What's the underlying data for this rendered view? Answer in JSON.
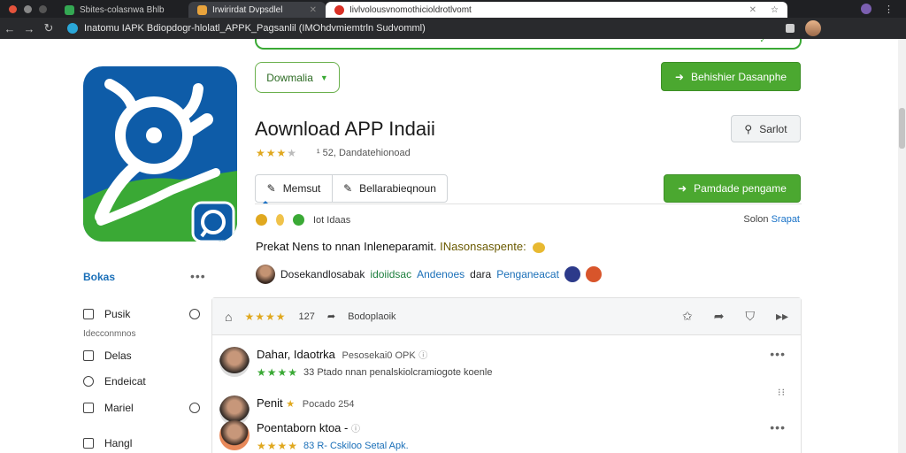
{
  "browser": {
    "tabs": [
      {
        "title": "Sbites-colasnwa Bhlb",
        "favicon_color": "#34a853"
      },
      {
        "title": "Irwirirdat Dvpsdlel",
        "favicon_color": "#e8a33c"
      },
      {
        "title": "Iivlvolousvnomothicioldrotlvomt",
        "favicon_color": "#d93025"
      }
    ],
    "address": "Inatomu IAPK Bdiopdogr-hlolatl_APPK_Pagsanlil (IMOhdvmiemtrln Sudvomml)"
  },
  "app": {
    "title": "Aownload APP Indaii",
    "rating_count": "     ¹ 52, Dandatehionoad",
    "dropdown_label": "Dowmalia",
    "primary_button": "Behishier Dasanphe",
    "share_button": "Sarlot",
    "tab_left": "Memsut",
    "tab_right": "Bellarabieqnoun",
    "install_button": "Pamdade pengame",
    "meta_text": "Iot Idaas",
    "solon_text": "Solon",
    "solon_link": "Srapat",
    "description": "Prekat Nens to nnan Inleneparamit.",
    "description_highlight": "INasonsaspente:",
    "developer_text": "Dosekandlosabak",
    "developer_green": "idoiidsac",
    "developer_blue": "Andenoes",
    "developer_mid": "dara",
    "developer_link": "Penganeacat"
  },
  "sidebar": {
    "heading": "Bokas",
    "items": [
      {
        "label": "Pusik"
      },
      {
        "label": "Delas"
      },
      {
        "label": "Endeicat"
      },
      {
        "label": "Mariel"
      },
      {
        "label": "Hangl"
      }
    ],
    "subtitle": "Idecconmnos"
  },
  "reviews": {
    "toolbar_count": "127",
    "toolbar_label": "Bodoplaoik",
    "items": [
      {
        "name": "Dahar, Idaotrka",
        "sub": "Pesosekai0 OPK",
        "text": "33 Ptado nnan penalskiolcramiogote koenle",
        "stars": 4
      },
      {
        "name": "Penit",
        "sub": "Pocado 254",
        "text": "",
        "stars": 1
      },
      {
        "name": "Poentaborn ktoa -",
        "sub": "",
        "text": "83 R- Cskiloo Setal Apk.",
        "stars": 4
      }
    ]
  },
  "colors": {
    "accent_green": "#4ba830",
    "brand_blue": "#0e5ca8",
    "link_blue": "#1a6fb8"
  }
}
